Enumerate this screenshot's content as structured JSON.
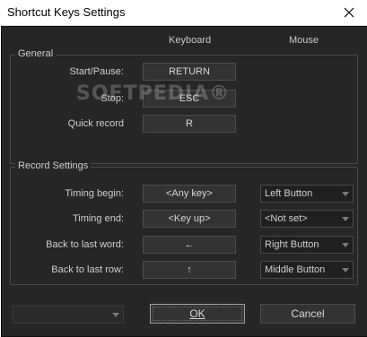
{
  "window": {
    "title": "Shortcut Keys Settings",
    "close_glyph": "✕"
  },
  "columns": {
    "keyboard": "Keyboard",
    "mouse": "Mouse"
  },
  "general": {
    "title": "General",
    "rows": [
      {
        "label": "Start/Pause:",
        "key": "RETURN"
      },
      {
        "label": "Stop:",
        "key": "ESC"
      },
      {
        "label": "Quick record",
        "key": "R"
      }
    ]
  },
  "record_settings": {
    "title": "Record Settings",
    "rows": [
      {
        "label": "Timing begin:",
        "key": "<Any key>",
        "mouse": "Left Button"
      },
      {
        "label": "Timing end:",
        "key": "<Key up>",
        "mouse": "<Not set>"
      },
      {
        "label": "Back to last word:",
        "key": "←",
        "mouse": "Right Button"
      },
      {
        "label": "Back to last row:",
        "key": "↑",
        "mouse": "Middle Button"
      }
    ]
  },
  "buttons": {
    "ok": "OK",
    "cancel": "Cancel"
  },
  "watermark": "SOFTPEDIA®"
}
